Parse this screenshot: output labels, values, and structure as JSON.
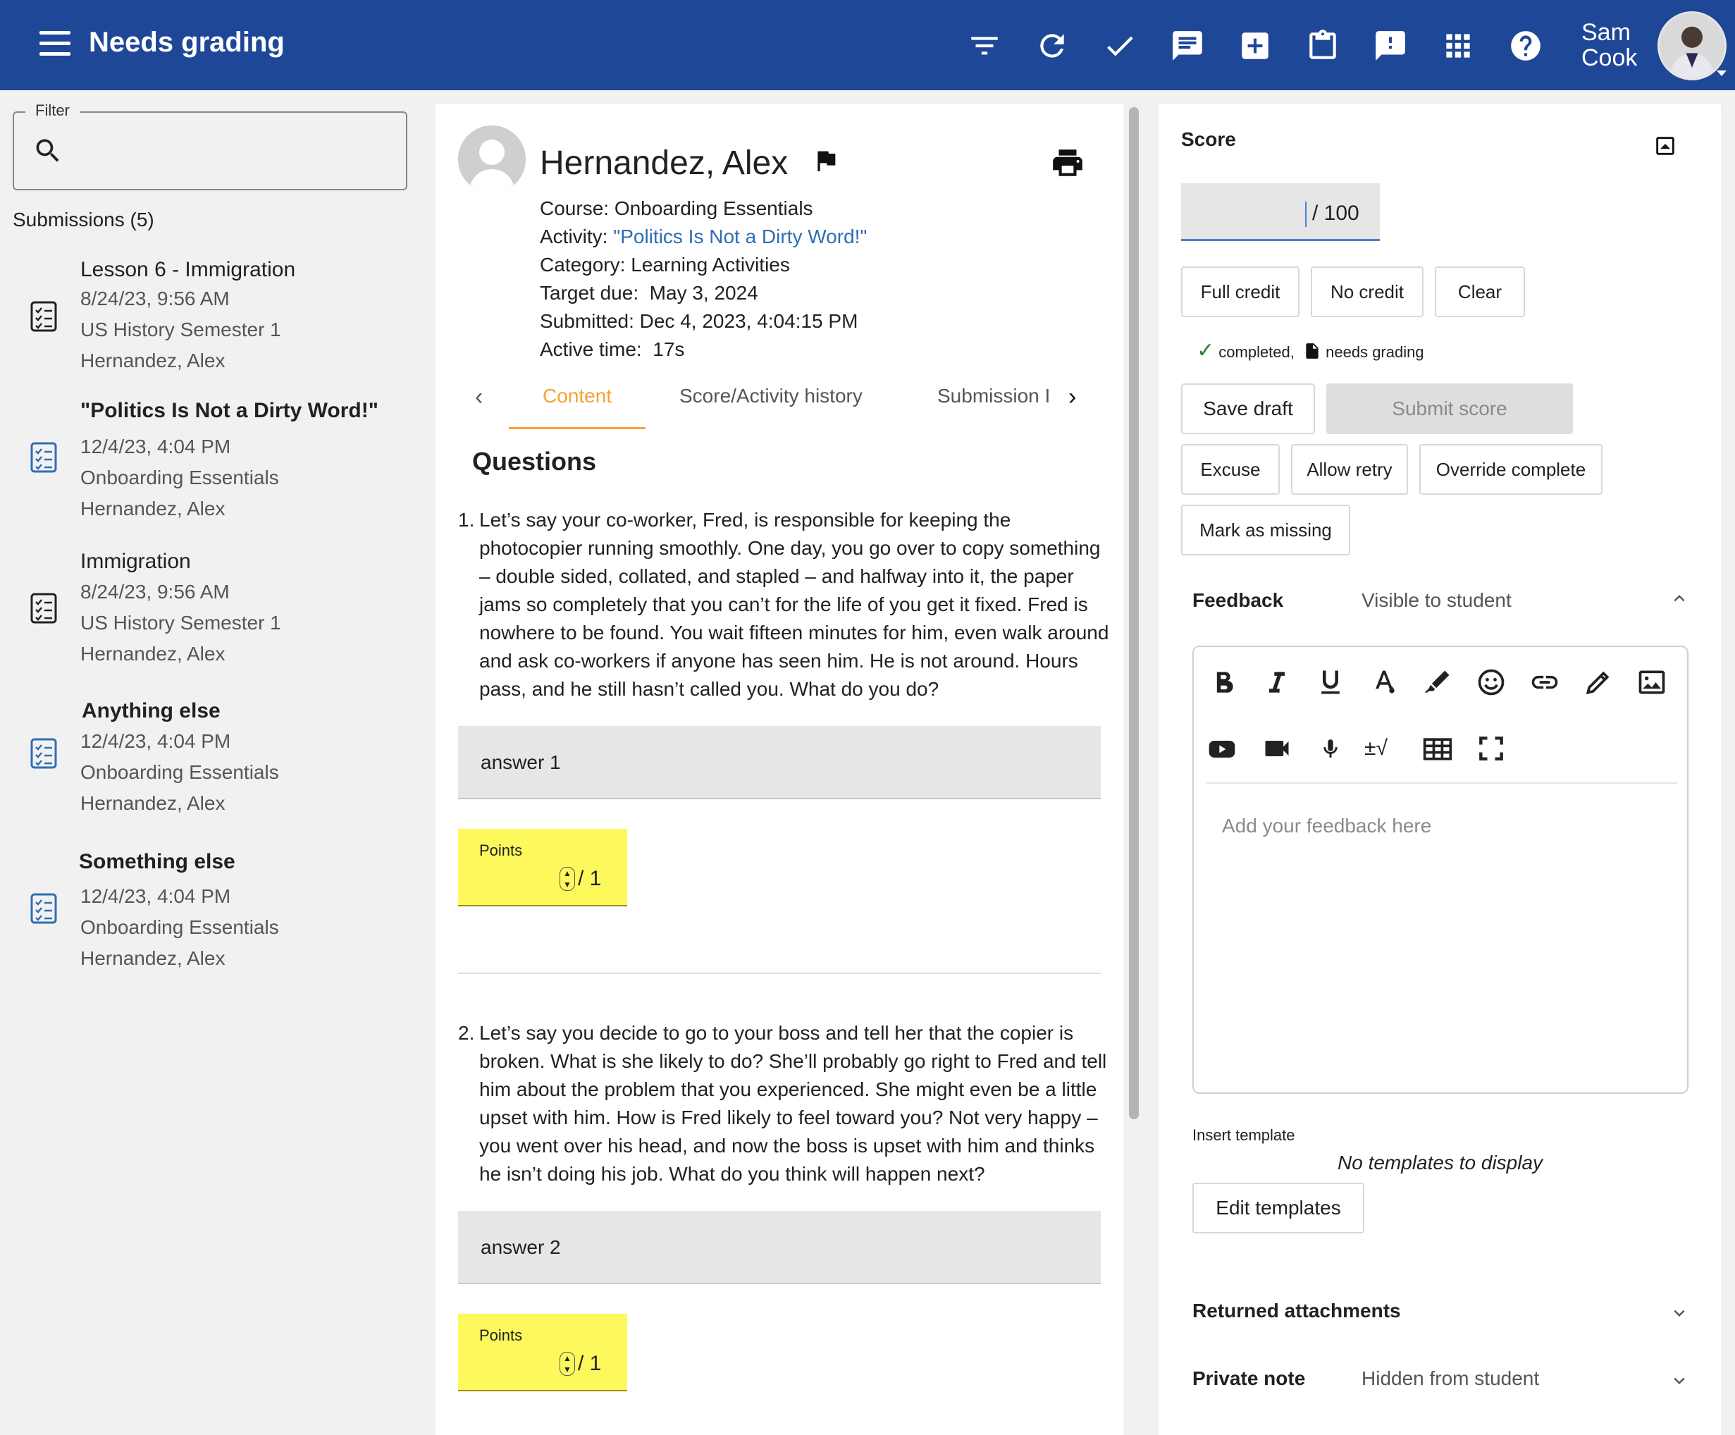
{
  "header": {
    "title": "Needs grading",
    "user_name_first": "Sam",
    "user_name_last": "Cook",
    "icons": [
      "menu-icon",
      "filter-list-icon",
      "refresh-icon",
      "check-icon",
      "comment-icon",
      "add-box-icon",
      "clipboard-icon",
      "alert-message-icon",
      "apps-grid-icon",
      "help-icon"
    ]
  },
  "filter": {
    "label": "Filter",
    "placeholder": ""
  },
  "submissions": {
    "title": "Submissions (5)",
    "items": [
      {
        "title": "Lesson 6 - Immigration",
        "bold": false,
        "date": "8/24/23, 9:56 AM",
        "course": "US History Semester 1",
        "student": "Hernandez, Alex",
        "icon": "assignment-list-icon"
      },
      {
        "title": "\"Politics Is Not a Dirty Word!\"",
        "bold": true,
        "date": "12/4/23, 4:04 PM",
        "course": "Onboarding Essentials",
        "student": "Hernandez, Alex",
        "icon": "assignment-list-icon"
      },
      {
        "title": "Immigration",
        "bold": false,
        "date": "8/24/23, 9:56 AM",
        "course": "US History Semester 1",
        "student": "Hernandez, Alex",
        "icon": "assignment-list-icon"
      },
      {
        "title": "Anything else",
        "bold": true,
        "date": "12/4/23, 4:04 PM",
        "course": "Onboarding Essentials",
        "student": "Hernandez, Alex",
        "icon": "assignment-list-icon"
      },
      {
        "title": "Something else",
        "bold": true,
        "date": "12/4/23, 4:04 PM",
        "course": "Onboarding Essentials",
        "student": "Hernandez, Alex",
        "icon": "assignment-list-icon"
      }
    ]
  },
  "student": {
    "name": "Hernandez, Alex",
    "course_label": "Course:",
    "course": "Onboarding Essentials",
    "activity_label": "Activity:",
    "activity": "\"Politics Is Not a Dirty Word!\"",
    "category_label": "Category:",
    "category": "Learning Activities",
    "target_due_label": "Target due:",
    "target_due": "May 3, 2024",
    "submitted_label": "Submitted:",
    "submitted": "Dec 4, 2023, 4:04:15 PM",
    "active_time_label": "Active time:",
    "active_time": "17s"
  },
  "tabs": [
    {
      "label": "Content",
      "active": true
    },
    {
      "label": "Score/Activity history",
      "active": false
    },
    {
      "label": "Submission I",
      "active": false
    }
  ],
  "content": {
    "questions_heading": "Questions",
    "questions": [
      {
        "number": "1.",
        "text": "Let’s say your co-worker, Fred, is responsible for keeping the photocopier running smoothly. One day, you go over to copy something – double sided, collated, and stapled – and halfway into it, the paper jams so completely that you can’t for the life of you get it fixed. Fred is nowhere to be found. You wait fifteen minutes for him, even walk around and ask co-workers if anyone has seen him. He is not around. Hours pass, and he still hasn’t called you. What do you do?",
        "answer": "answer 1",
        "points_label": "Points",
        "points_max": "/ 1"
      },
      {
        "number": "2.",
        "text": "Let’s say you decide to go to your boss and tell her that the copier is broken. What is she likely to do? She’ll probably go right to Fred and tell him about the problem that you experienced. She might even be a little upset with him. How is Fred likely to feel toward you? Not very happy – you went over his head, and now the boss is upset with him and thinks he isn’t doing his job. What do you think will happen next?",
        "answer": "answer 2",
        "points_label": "Points",
        "points_max": "/ 1"
      }
    ]
  },
  "score": {
    "label": "Score",
    "value": "",
    "max": "/ 100",
    "full_credit": "Full credit",
    "no_credit": "No credit",
    "clear": "Clear",
    "status_completed": "completed,",
    "status_needs_grading": "needs grading",
    "save_draft": "Save draft",
    "submit_score": "Submit score",
    "excuse": "Excuse",
    "allow_retry": "Allow retry",
    "override_complete": "Override complete",
    "mark_missing": "Mark as missing"
  },
  "feedback": {
    "label": "Feedback",
    "visibility": "Visible to student",
    "placeholder": "Add your feedback here",
    "toolbar_row1": [
      "bold-icon",
      "italic-icon",
      "underline-icon",
      "text-color-icon",
      "highlighter-icon",
      "emoji-icon",
      "link-icon",
      "pencil-icon",
      "image-icon"
    ],
    "toolbar_row2": [
      "youtube-icon",
      "video-camera-icon",
      "microphone-icon",
      "math-formula-icon",
      "table-icon",
      "fullscreen-icon"
    ],
    "math_glyph": "±√"
  },
  "templates": {
    "label": "Insert template",
    "empty": "No templates to display",
    "edit": "Edit templates"
  },
  "returned_attachments": {
    "label": "Returned attachments"
  },
  "private_note": {
    "label": "Private note",
    "visibility": "Hidden from student"
  }
}
